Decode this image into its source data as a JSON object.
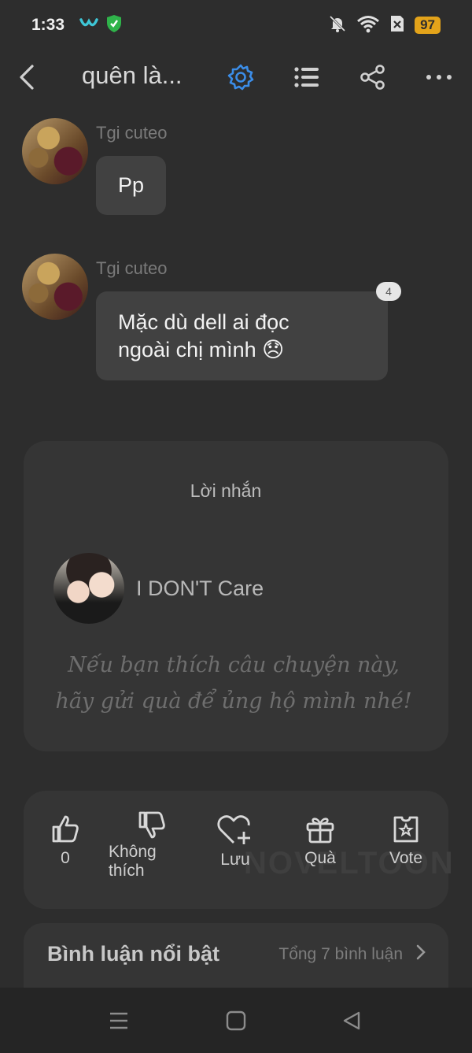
{
  "status": {
    "time": "1:33",
    "battery": "97"
  },
  "header": {
    "title": "quên là..."
  },
  "messages": [
    {
      "sender": "Tgi cuteo",
      "text": "Pp"
    },
    {
      "sender": "Tgi cuteo",
      "text_line1": "Mặc dù dell ai đọc",
      "text_line2": "ngoài chị mình 😞",
      "badge": "4"
    }
  ],
  "author_card": {
    "title": "Lời nhắn",
    "author_name": "I DON'T Care",
    "quote_line1": "Nếu bạn thích câu chuyện này,",
    "quote_line2": "hãy gửi quà để ủng hộ mình nhé!"
  },
  "actions": {
    "like_count": "0",
    "dislike_line1": "Không",
    "dislike_line2": "thích",
    "save": "Lưu",
    "gift": "Quà",
    "vote": "Vote",
    "watermark": "NOVELTOON"
  },
  "comments": {
    "title": "Bình luận nổi bật",
    "total": "Tổng 7 bình luận"
  },
  "colors": {
    "accent": "#3b8de8",
    "battery": "#e3a31a",
    "background": "#2d2d2d"
  }
}
